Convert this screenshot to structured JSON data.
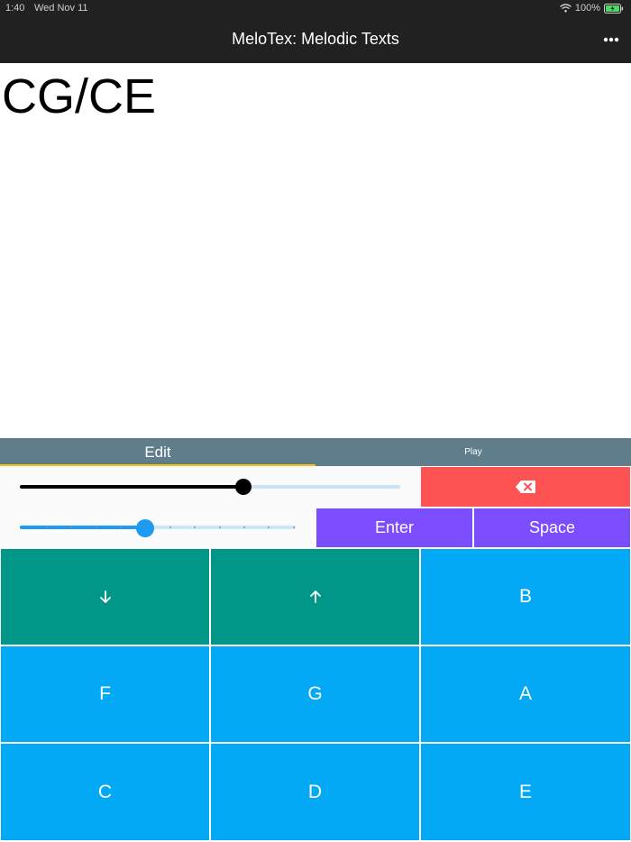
{
  "status_bar": {
    "time": "1:40",
    "date": "Wed Nov 11",
    "battery": "100%"
  },
  "app_bar": {
    "title": "MeloTex: Melodic Texts",
    "menu_icon": "more-horizontal-icon"
  },
  "editor": {
    "text": "CG/CE"
  },
  "tabs": [
    {
      "label": "Edit",
      "active": true
    },
    {
      "label": "Play",
      "active": false
    }
  ],
  "controls": {
    "slider_1_level": 0.59,
    "slider_2_level": 0.45,
    "backspace_icon": "backspace-icon",
    "enter_label": "Enter",
    "space_label": "Space"
  },
  "keys": [
    {
      "id": "down",
      "label": "",
      "icon": "arrow-down-icon",
      "color": "#009688"
    },
    {
      "id": "up",
      "label": "",
      "icon": "arrow-up-icon",
      "color": "#009688"
    },
    {
      "id": "b",
      "label": "B",
      "color": "#03a9f4"
    },
    {
      "id": "f",
      "label": "F",
      "color": "#03a9f4"
    },
    {
      "id": "g",
      "label": "G",
      "color": "#03a9f4"
    },
    {
      "id": "a",
      "label": "A",
      "color": "#03a9f4"
    },
    {
      "id": "c",
      "label": "C",
      "color": "#03a9f4"
    },
    {
      "id": "d",
      "label": "D",
      "color": "#03a9f4"
    },
    {
      "id": "e",
      "label": "E",
      "color": "#03a9f4"
    }
  ],
  "colors": {
    "app_bar": "#212121",
    "tab_bar": "#607d8b",
    "tab_indicator": "#ffc107",
    "backspace": "#fe5253",
    "action": "#7c4dff",
    "note_key": "#03a9f4",
    "arrow_key": "#009688",
    "slider_accent": "#1e9bf0"
  }
}
